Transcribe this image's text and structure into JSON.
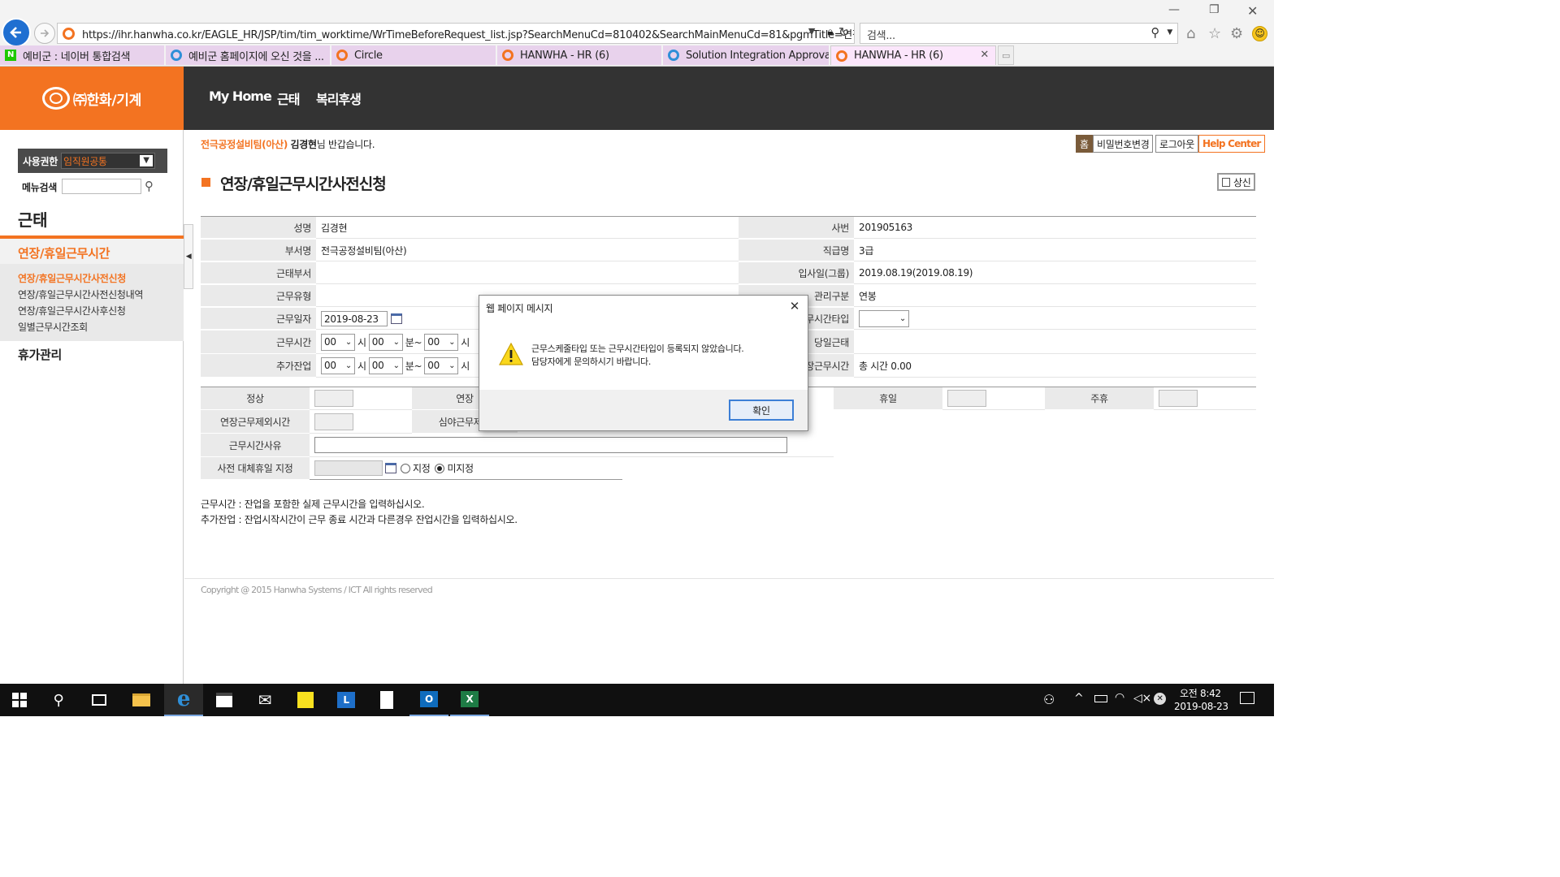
{
  "browser": {
    "url": "https://ihr.hanwha.co.kr/EAGLE_HR/JSP/tim/tim_worktime/WrTimeBeforeRequest_list.jsp?SearchMenuCd=810402&SearchMainMenuCd=81&pgmTitle=연장/휴일",
    "search_placeholder": "검색...",
    "tabs": [
      {
        "label": "예비군 : 네이버 통합검색",
        "icon": "naver-icon"
      },
      {
        "label": "예비군 홈페이지에 오신 것을 ...",
        "icon": "ie-icon"
      },
      {
        "label": "Circle",
        "icon": "hanwha-icon"
      },
      {
        "label": "HANWHA - HR (6)",
        "icon": "hanwha-icon"
      },
      {
        "label": "Solution Integration Approval...",
        "icon": "ie-icon"
      },
      {
        "label": "HANWHA - HR (6)",
        "icon": "hanwha-icon",
        "active": true
      }
    ]
  },
  "header": {
    "logo_text": "㈜한화/기계",
    "nav": [
      "My Home",
      "근태",
      "복리후생"
    ]
  },
  "left": {
    "role_label": "사용권한",
    "role_value": "임직원공통",
    "menu_search_label": "메뉴검색",
    "section_title": "근태",
    "group_title": "연장/휴일근무시간",
    "items": [
      "연장/휴일근무시간사전신청",
      "연장/휴일근무시간사전신청내역",
      "연장/휴일근무시간사후신청",
      "일별근무시간조회"
    ],
    "group2_title": "휴가관리"
  },
  "topbar": {
    "dept": "전극공정설비팀(아산)",
    "user": "김경현",
    "greeting": "님 반갑습니다.",
    "home_btn": "홈",
    "pw_btn": "비밀번호변경",
    "logout_btn": "로그아웃",
    "help_btn": "Help Center"
  },
  "page": {
    "title": "연장/휴일근무시간사전신청",
    "submit_btn": "상신",
    "form": {
      "name_label": "성명",
      "name_value": "김경현",
      "empno_label": "사번",
      "empno_value": "201905163",
      "dept_label": "부서명",
      "dept_value": "전극공정설비팀(아산)",
      "grade_label": "직급명",
      "grade_value": "3급",
      "workdept_label": "근태부서",
      "joindate_label": "입사일(그룹)",
      "joindate_value": "2019.08.19(2019.08.19)",
      "worktype_label": "근무유형",
      "mgmt_label": "관리구분",
      "mgmt_value": "연봉",
      "workdate_label": "근무일자",
      "workdate_value": "2019-08-23",
      "timetype_label": "근무시간타입",
      "worktime_label": "근무시간",
      "dayattend_label": "당일근태",
      "overtime_label": "추가잔업",
      "extend_label": "연장근무시간",
      "extend_value": "총 시간 0.00",
      "hour_unit": "시",
      "min_unit": "분~",
      "select_value": "00"
    },
    "summary": {
      "normal_label": "정상",
      "ext_label": "연장",
      "holiday_label": "휴일",
      "weekly_label": "주휴",
      "ext_excl_label": "연장근무제외시간",
      "night_excl_label": "심야근무제외",
      "reason_label": "근무시간사유",
      "sub_holiday_label": "사전 대체휴일 지정",
      "radio_designate": "지정",
      "radio_undesignate": "미지정"
    },
    "notes": [
      "근무시간 : 잔업을 포함한 실제 근무시간을 입력하십시오.",
      "추가잔업 : 잔업시작시간이 근무 종료 시간과 다른경우 잔업시간을 입력하십시오."
    ],
    "copyright": "Copyright @ 2015 Hanwha Systems / ICT All rights reserved"
  },
  "dialog": {
    "title": "웹 페이지 메시지",
    "message_line1": "근무스케줄타입 또는 근무시간타입이 등록되지 않았습니다.",
    "message_line2": "담당자에게 문의하시기 바랍니다.",
    "ok_btn": "확인"
  },
  "taskbar": {
    "time": "오전 8:42",
    "date": "2019-08-23"
  }
}
